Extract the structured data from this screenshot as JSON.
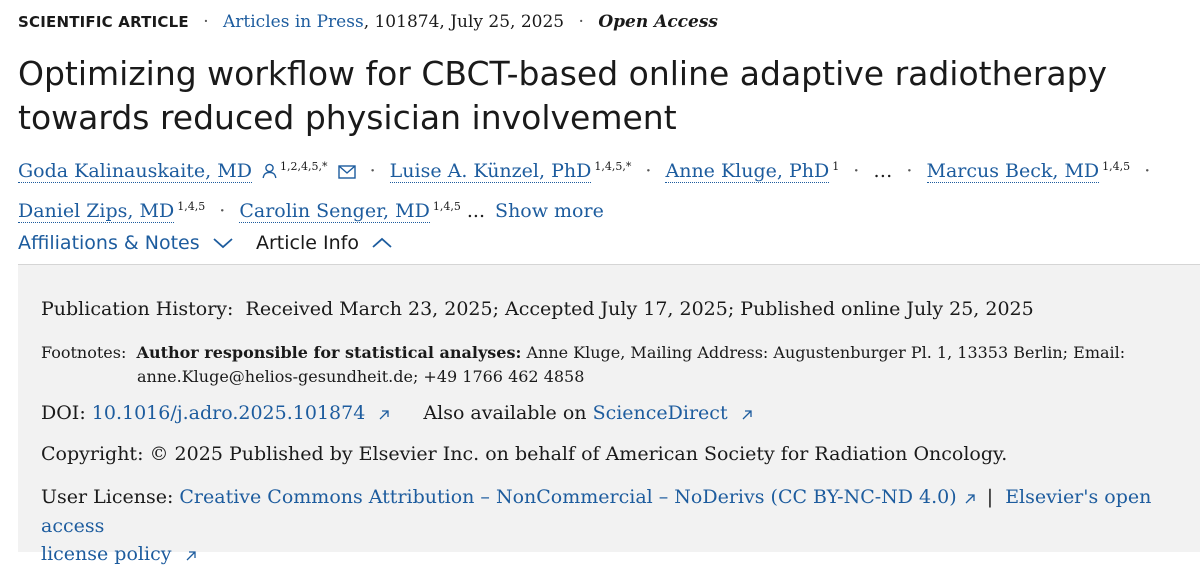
{
  "article": {
    "type": "SCIENTIFIC ARTICLE",
    "journal_info": "Articles in Press",
    "issue_info": ", 101874, July 25, 2025",
    "access": "Open Access",
    "title": "Optimizing workflow for CBCT-based online adaptive radiotherapy towards reduced physician involvement"
  },
  "authors": [
    {
      "name": "Goda Kalinauskaite, MD",
      "sup": "1,2,4,5,*"
    },
    {
      "name": "Luise A. Künzel, PhD",
      "sup": "1,4,5,*"
    },
    {
      "name": "Anne Kluge, PhD",
      "sup": "1"
    },
    {
      "name": "Marcus Beck, MD",
      "sup": "1,4,5"
    },
    {
      "name": "Daniel Zips, MD",
      "sup": "1,4,5"
    },
    {
      "name": "Carolin Senger, MD",
      "sup": "1,4,5"
    }
  ],
  "authors_ellipsis": "…",
  "authors_more_ellipsis": "...",
  "show_more": "Show more",
  "tabs": [
    {
      "label": "Affiliations & Notes",
      "active": false
    },
    {
      "label": "Article Info",
      "active": true
    }
  ],
  "info": {
    "history_label": "Publication History:",
    "history_value": "Received March 23, 2025; Accepted July 17, 2025; Published online July 25, 2025",
    "footnotes_label": "Footnotes:",
    "footnotes_bold": "Author responsible for statistical analyses:",
    "footnotes_value_1": "Anne Kluge, Mailing Address: Augustenburger Pl. 1, 13353 Berlin; Email:",
    "footnotes_value_2": "anne.Kluge@helios-gesundheit.de; +49 1766 462 4858",
    "doi_label": "DOI:",
    "doi_value": "10.1016/j.adro.2025.101874",
    "also_label": "Also available on",
    "also_link": "ScienceDirect",
    "copyright_label": "Copyright:",
    "copyright_value": "© 2025 Published by Elsevier Inc. on behalf of American Society for Radiation Oncology.",
    "license_label": "User License:",
    "license_link": "Creative Commons Attribution – NonCommercial – NoDerivs (CC BY-NC-ND 4.0)",
    "license_sep": "|",
    "policy_link_1": "Elsevier's open access",
    "policy_link_2": "license policy"
  },
  "colors": {
    "link": "#1d5c9e",
    "panel_bg": "#f2f2f2",
    "text": "#1a1a1a"
  }
}
